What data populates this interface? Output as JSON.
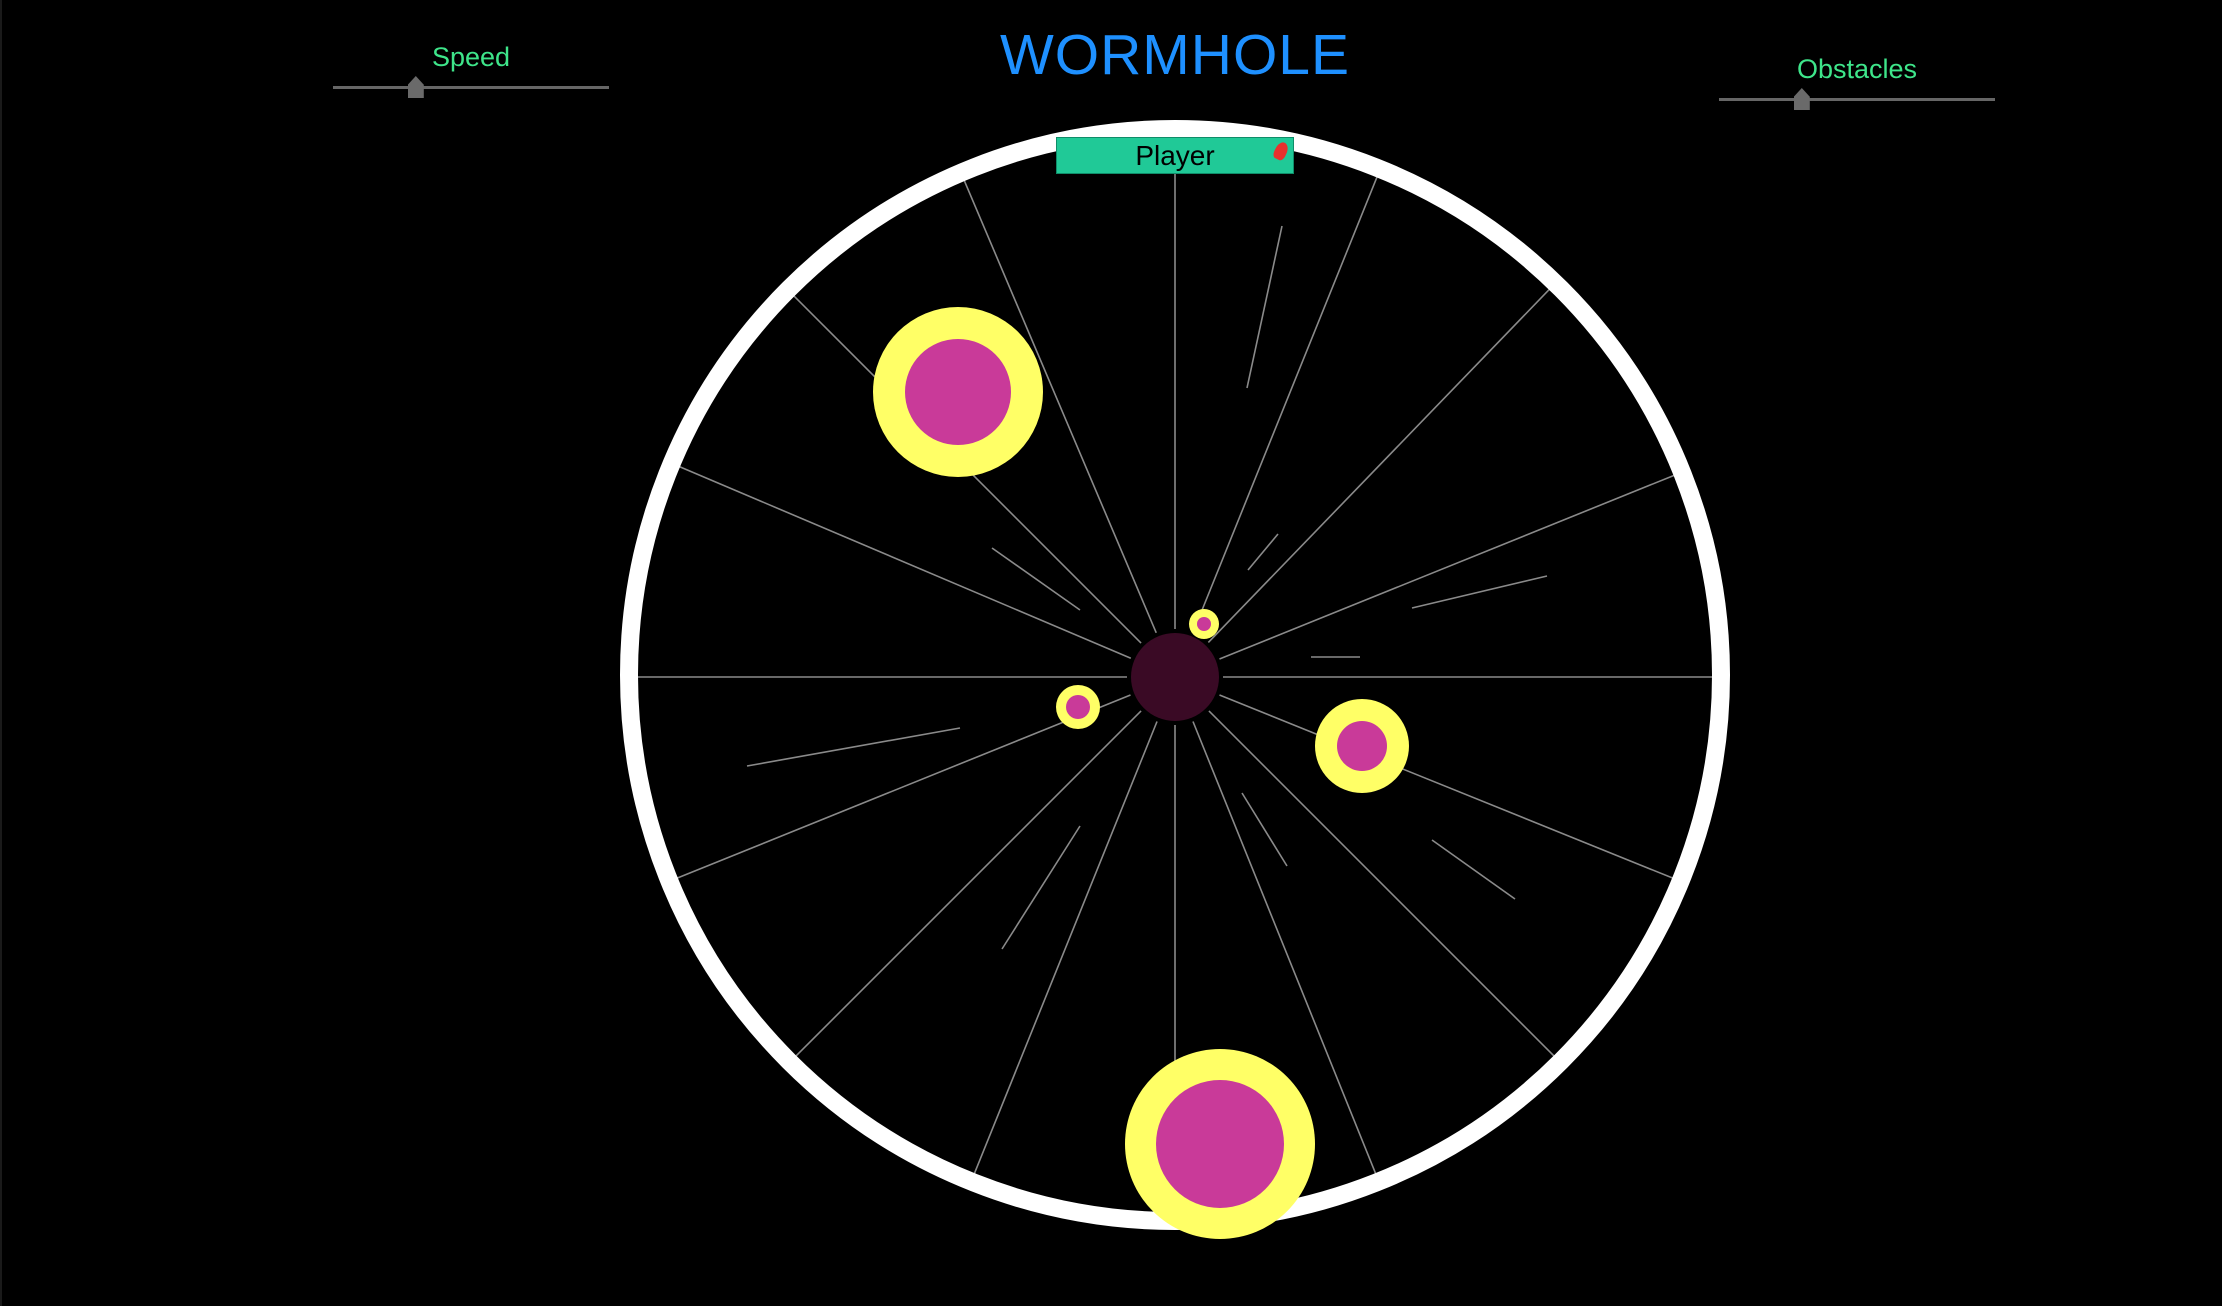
{
  "game": {
    "title": "WORMHOLE",
    "title_color": "#1e90ff",
    "label_color": "#3ee58a"
  },
  "controls": {
    "speed": {
      "label": "Speed",
      "level": 0.3
    },
    "obstacles": {
      "label": "Obstacles",
      "level": 0.3
    }
  },
  "player": {
    "label": "Player",
    "box_color": "#20c997",
    "marker_color": "#e8322d"
  },
  "tunnel": {
    "ring_color": "#ffffff",
    "spoke_color": "#8a8a8a",
    "core_color": "#3a0a25",
    "obstacle_outer_color": "#ffff66",
    "obstacle_inner_color": "#c93a99"
  }
}
